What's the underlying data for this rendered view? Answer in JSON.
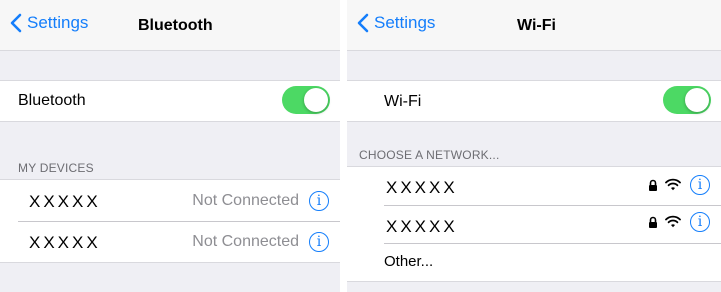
{
  "bluetooth_screen": {
    "back_label": "Settings",
    "title": "Bluetooth",
    "toggle_label": "Bluetooth",
    "toggle_on": true,
    "section_header": "MY DEVICES",
    "devices": [
      {
        "name": "XXXXX",
        "status": "Not Connected"
      },
      {
        "name": "XXXXX",
        "status": "Not Connected"
      }
    ]
  },
  "wifi_screen": {
    "back_label": "Settings",
    "title": "Wi-Fi",
    "toggle_label": "Wi-Fi",
    "toggle_on": true,
    "section_header": "CHOOSE A NETWORK...",
    "networks": [
      {
        "name": "XXXXX",
        "secured": true,
        "icons": [
          "lock-icon",
          "wifi-signal-icon",
          "info-icon"
        ]
      },
      {
        "name": "XXXXX",
        "secured": true,
        "icons": [
          "lock-icon",
          "wifi-signal-icon",
          "info-icon"
        ]
      }
    ],
    "other_label": "Other..."
  },
  "info_glyph": "i",
  "colors": {
    "accent": "#147efb",
    "toggle_on": "#4cd964",
    "grouped_bg": "#efeff4",
    "secondary_text": "#8e8e93"
  }
}
